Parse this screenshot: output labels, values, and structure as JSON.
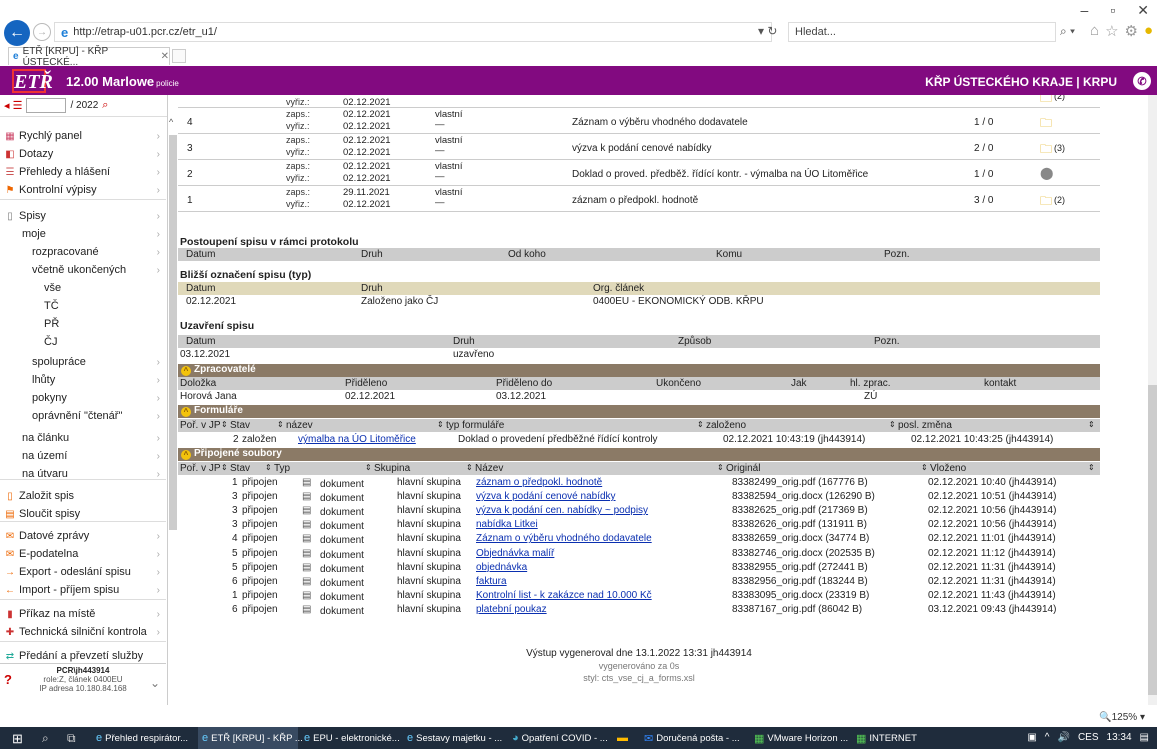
{
  "browser": {
    "url": "http://etrap-u01.pcr.cz/etr_u1/",
    "search_placeholder": "Hledat...",
    "tab_title": "ETŘ [KRPU] - KŘP ÚSTECKÉ...",
    "zoom": "125%"
  },
  "app": {
    "title": "12.00 Marlowe",
    "subtitle": "policie",
    "org": "KŘP ÚSTECKÉHO KRAJE | KRPU",
    "logo": "ETŘ"
  },
  "sidebar": {
    "year_suffix": "/ 2022",
    "items": [
      {
        "label": "Rychlý panel",
        "icon": "panel-icon"
      },
      {
        "label": "Dotazy",
        "icon": "query-icon"
      },
      {
        "label": "Přehledy a hlášení",
        "icon": "report-icon"
      },
      {
        "label": "Kontrolní výpisy",
        "icon": "check-icon"
      },
      {
        "label": "Spisy",
        "icon": "folder-icon"
      },
      {
        "label": "moje"
      },
      {
        "label": "rozpracované"
      },
      {
        "label": "včetně ukončených"
      },
      {
        "label": "vše"
      },
      {
        "label": "TČ"
      },
      {
        "label": "PŘ"
      },
      {
        "label": "ČJ"
      },
      {
        "label": "spolupráce"
      },
      {
        "label": "lhůty"
      },
      {
        "label": "pokyny"
      },
      {
        "label": "oprávnění \"čtenář\""
      },
      {
        "label": "na článku"
      },
      {
        "label": "na území"
      },
      {
        "label": "na útvaru"
      },
      {
        "label": "Založit spis"
      },
      {
        "label": "Sloučit spisy"
      },
      {
        "label": "Datové zprávy"
      },
      {
        "label": "E-podatelna"
      },
      {
        "label": "Export - odeslání spisu"
      },
      {
        "label": "Import - příjem spisu"
      },
      {
        "label": "Příkaz na místě"
      },
      {
        "label": "Technická silniční kontrola"
      },
      {
        "label": "Předání a převzetí služby"
      }
    ],
    "footer": {
      "user": "PCR\\jh443914",
      "role": "role:Z, článek 0400EU",
      "ip": "IP adresa 10.180.84.168"
    }
  },
  "history": {
    "zaps_label": "zaps.:",
    "vyriz_label": "vyřiz.:",
    "rows": [
      {
        "num": "4",
        "zaps": "02.12.2021",
        "vyriz": "02.12.2021",
        "vl": "vlastní",
        "desc": "Záznam o výběru vhodného dodavatele",
        "cnt": "1 / 0",
        "att": ""
      },
      {
        "num": "3",
        "zaps": "02.12.2021",
        "vyriz": "02.12.2021",
        "vl": "vlastní",
        "desc": "výzva k podání cenové nabídky",
        "cnt": "2 / 0",
        "att": "(3)"
      },
      {
        "num": "2",
        "zaps": "02.12.2021",
        "vyriz": "02.12.2021",
        "vl": "vlastní",
        "desc": "Doklad o proved. předběž. řídící kontr. - výmalba na ÚO Litoměřice",
        "cnt": "1 / 0",
        "att": ""
      },
      {
        "num": "1",
        "zaps": "29.11.2021",
        "vyriz": "02.12.2021",
        "vl": "vlastní",
        "desc": "záznam o předpokl. hodnotě",
        "cnt": "3 / 0",
        "att": "(2)"
      }
    ],
    "top_partial": {
      "vyriz": "02.12.2021",
      "att": "(2)"
    }
  },
  "postoupeni": {
    "title": "Postoupení spisu v rámci protokolu",
    "cols": [
      "Datum",
      "Druh",
      "Od koho",
      "Komu",
      "Pozn."
    ]
  },
  "blizsi": {
    "title": "Bližší označení spisu (typ)",
    "cols": [
      "Datum",
      "Druh",
      "Org. článek"
    ],
    "vals": [
      "02.12.2021",
      "Založeno jako ČJ",
      "0400EU - EKONOMICKÝ ODB. KŘPU"
    ]
  },
  "uzavreni": {
    "title": "Uzavření spisu",
    "cols": [
      "Datum",
      "Druh",
      "Způsob",
      "Pozn."
    ],
    "vals": [
      "03.12.2021",
      "uzavřeno"
    ]
  },
  "zpracovatele": {
    "title": "Zpracovatelé",
    "cols": [
      "Doložka",
      "Přiděleno",
      "Přiděleno do",
      "Ukončeno",
      "Jak",
      "hl. zprac.",
      "kontakt"
    ],
    "vals": [
      "Horová Jana",
      "02.12.2021",
      "03.12.2021",
      "",
      "",
      "ZÚ",
      ""
    ]
  },
  "formulare": {
    "title": "Formuláře",
    "cols": [
      "Poř. v JP",
      "Stav",
      "název",
      "typ formuláře",
      "založeno",
      "posl. změna"
    ],
    "rows": [
      {
        "por": "2",
        "stav": "založen",
        "nazev": "výmalba na ÚO Litoměřice",
        "typ": "Doklad o provedení předběžné řídící kontroly",
        "zal": "02.12.2021 10:43:19 (jh443914)",
        "zmena": "02.12.2021 10:43:25 (jh443914)"
      }
    ]
  },
  "soubory": {
    "title": "Připojené soubory",
    "cols": [
      "Poř. v JP",
      "Stav",
      "Typ",
      "Skupina",
      "Název",
      "Originál",
      "Vloženo"
    ],
    "rows": [
      {
        "por": "1",
        "stav": "připojen",
        "typ": "dokument",
        "sk": "hlavní skupina",
        "nazev": "záznam o předpokl. hodnotě",
        "orig": "83382499_orig.pdf (167776 B)",
        "vl": "02.12.2021 10:40 (jh443914)"
      },
      {
        "por": "3",
        "stav": "připojen",
        "typ": "dokument",
        "sk": "hlavní skupina",
        "nazev": "výzva k podání cenové nabídky",
        "orig": "83382594_orig.docx (126290 B)",
        "vl": "02.12.2021 10:51 (jh443914)"
      },
      {
        "por": "3",
        "stav": "připojen",
        "typ": "dokument",
        "sk": "hlavní skupina",
        "nazev": "výzva k podání cen. nabídky ~ podpisy",
        "orig": "83382625_orig.pdf (217369 B)",
        "vl": "02.12.2021 10:56 (jh443914)"
      },
      {
        "por": "3",
        "stav": "připojen",
        "typ": "dokument",
        "sk": "hlavní skupina",
        "nazev": "nabídka Litkei",
        "orig": "83382626_orig.pdf (131911 B)",
        "vl": "02.12.2021 10:56 (jh443914)"
      },
      {
        "por": "4",
        "stav": "připojen",
        "typ": "dokument",
        "sk": "hlavní skupina",
        "nazev": "Záznam o výběru vhodného dodavatele",
        "orig": "83382659_orig.docx (34774 B)",
        "vl": "02.12.2021 11:01 (jh443914)"
      },
      {
        "por": "5",
        "stav": "připojen",
        "typ": "dokument",
        "sk": "hlavní skupina",
        "nazev": "Objednávka malíř",
        "orig": "83382746_orig.docx (202535 B)",
        "vl": "02.12.2021 11:12 (jh443914)"
      },
      {
        "por": "5",
        "stav": "připojen",
        "typ": "dokument",
        "sk": "hlavní skupina",
        "nazev": "objednávka",
        "orig": "83382955_orig.pdf (272441 B)",
        "vl": "02.12.2021 11:31 (jh443914)"
      },
      {
        "por": "6",
        "stav": "připojen",
        "typ": "dokument",
        "sk": "hlavní skupina",
        "nazev": "faktura",
        "orig": "83382956_orig.pdf (183244 B)",
        "vl": "02.12.2021 11:31 (jh443914)"
      },
      {
        "por": "1",
        "stav": "připojen",
        "typ": "dokument",
        "sk": "hlavní skupina",
        "nazev": "Kontrolní list - k zakázce nad 10.000 Kč",
        "orig": "83383095_orig.docx (23319 B)",
        "vl": "02.12.2021 11:43 (jh443914)"
      },
      {
        "por": "6",
        "stav": "připojen",
        "typ": "dokument",
        "sk": "hlavní skupina",
        "nazev": "platební poukaz",
        "orig": "83387167_orig.pdf (86042 B)",
        "vl": "03.12.2021 09:43 (jh443914)"
      }
    ]
  },
  "footer": {
    "line1": "Výstup vygeneroval dne 13.1.2022 13:31 jh443914",
    "line2": "vygenerováno za 0s",
    "line3": "styl: cts_vse_cj_a_forms.xsl"
  },
  "taskbar": {
    "items": [
      "Přehled respirátor...",
      "ETŘ [KRPU] - KŘP ...",
      "EPU - elektronické...",
      "Sestavy majetku - ...",
      "Opatření COVID - ...",
      "",
      "Doručená pošta - ...",
      "VMware Horizon ...",
      "INTERNET"
    ],
    "lang": "CES",
    "time": "13:34"
  }
}
